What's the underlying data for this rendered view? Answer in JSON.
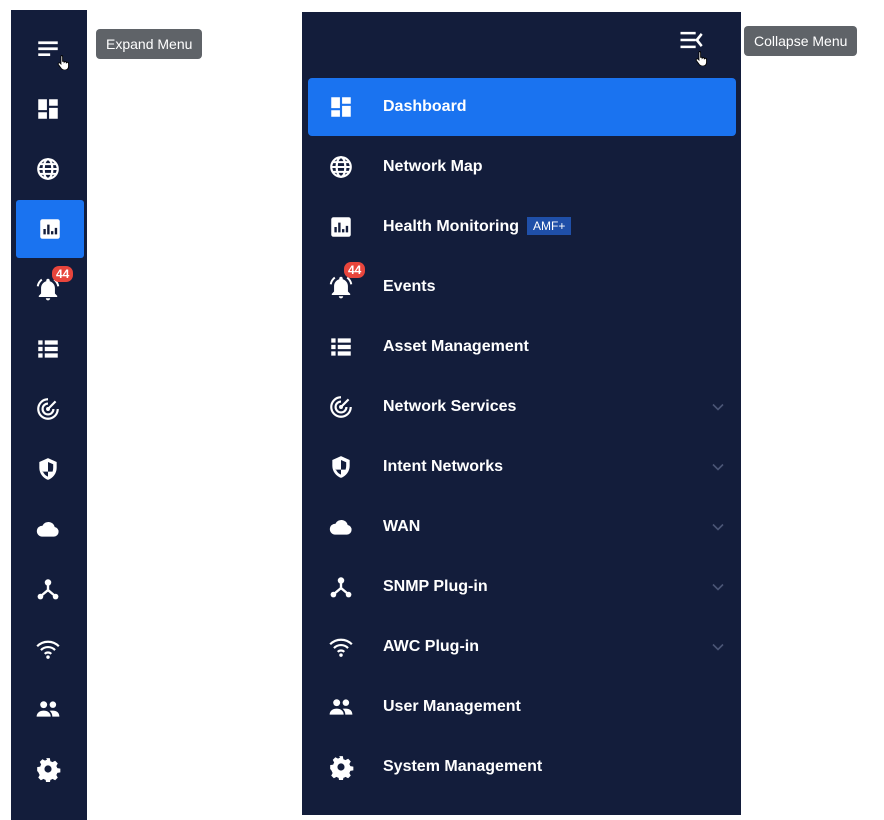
{
  "colors": {
    "background": "#131d3b",
    "active": "#1a73f0",
    "badge": "#e8453c",
    "tooltip": "#5f6368",
    "tag": "#1f4fa8"
  },
  "collapsed": {
    "tooltip": "Expand Menu",
    "active_index": 2,
    "events_badge": "44",
    "icons": [
      "dashboard-icon",
      "network-map-icon",
      "health-monitoring-icon",
      "events-bell-icon",
      "asset-management-icon",
      "network-services-icon",
      "intent-networks-icon",
      "wan-cloud-icon",
      "snmp-plugin-icon",
      "awc-wifi-icon",
      "user-management-icon",
      "system-management-gear-icon"
    ]
  },
  "expanded": {
    "tooltip": "Collapse Menu",
    "events_badge": "44",
    "items": [
      {
        "label": "Dashboard",
        "icon": "dashboard-icon",
        "active": true
      },
      {
        "label": "Network Map",
        "icon": "network-map-icon"
      },
      {
        "label": "Health Monitoring",
        "icon": "health-monitoring-icon",
        "tag": "AMF+"
      },
      {
        "label": "Events",
        "icon": "events-bell-icon"
      },
      {
        "label": "Asset Management",
        "icon": "asset-management-icon"
      },
      {
        "label": "Network Services",
        "icon": "network-services-icon",
        "expandable": true
      },
      {
        "label": "Intent Networks",
        "icon": "intent-networks-icon",
        "expandable": true
      },
      {
        "label": "WAN",
        "icon": "wan-cloud-icon",
        "expandable": true
      },
      {
        "label": "SNMP Plug-in",
        "icon": "snmp-plugin-icon",
        "expandable": true
      },
      {
        "label": "AWC Plug-in",
        "icon": "awc-wifi-icon",
        "expandable": true
      },
      {
        "label": "User Management",
        "icon": "user-management-icon"
      },
      {
        "label": "System Management",
        "icon": "system-management-gear-icon"
      }
    ]
  }
}
